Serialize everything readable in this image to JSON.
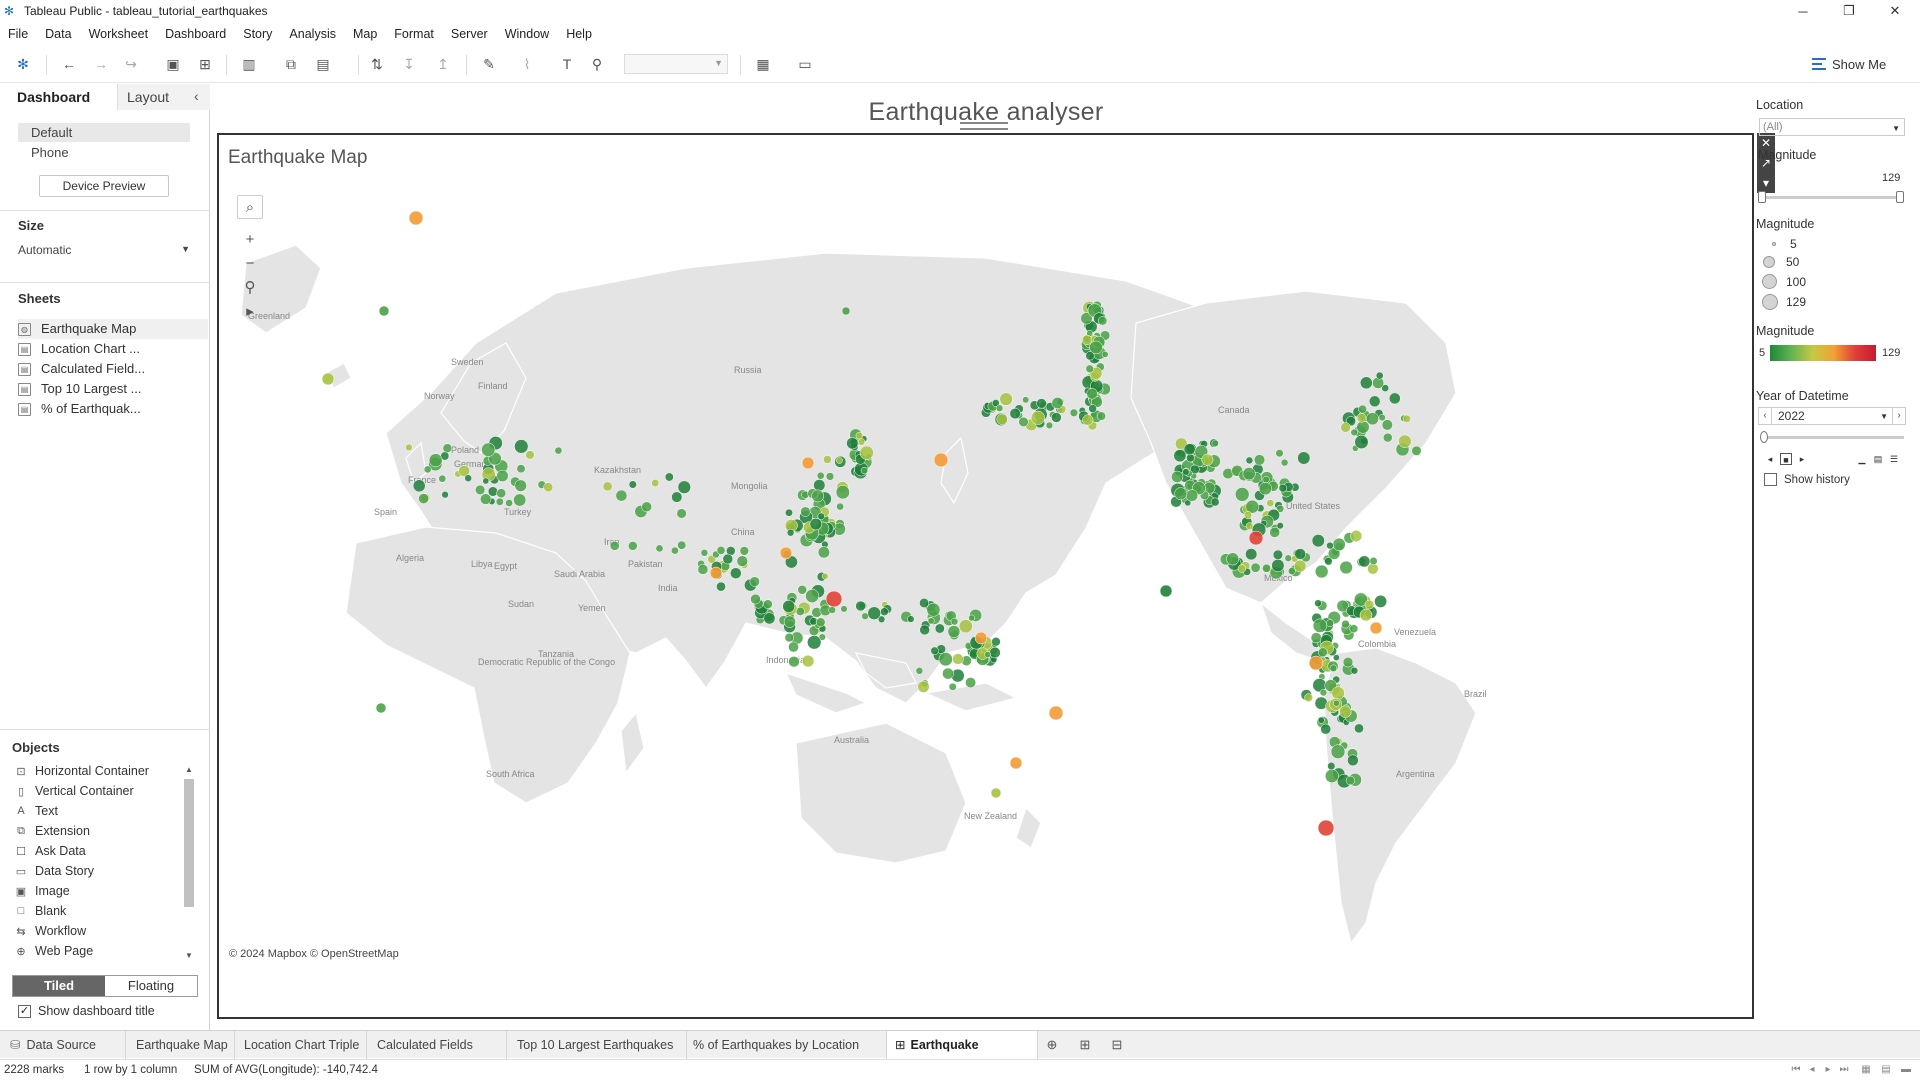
{
  "window": {
    "title": "Tableau Public - tableau_tutorial_earthquakes",
    "minimize": "─",
    "restore": "❐",
    "close": "✕"
  },
  "menu": [
    "File",
    "Data",
    "Worksheet",
    "Dashboard",
    "Story",
    "Analysis",
    "Map",
    "Format",
    "Server",
    "Window",
    "Help"
  ],
  "toolbar": {
    "show_me": "Show Me"
  },
  "left_panel": {
    "tab_dashboard": "Dashboard",
    "tab_layout": "Layout",
    "devices": [
      "Default",
      "Phone"
    ],
    "device_preview": "Device Preview",
    "size_heading": "Size",
    "size_value": "Automatic",
    "sheets_heading": "Sheets",
    "sheets": [
      "Earthquake Map",
      "Location Chart ...",
      "Calculated Field...",
      "Top 10 Largest ...",
      "% of Earthquak..."
    ],
    "objects_heading": "Objects",
    "objects": [
      {
        "icon": "horizontal-container-icon",
        "glyph": "⊡",
        "label": "Horizontal Container"
      },
      {
        "icon": "vertical-container-icon",
        "glyph": "▯",
        "label": "Vertical Container"
      },
      {
        "icon": "text-icon",
        "glyph": "A",
        "label": "Text"
      },
      {
        "icon": "extension-icon",
        "glyph": "⧉",
        "label": "Extension"
      },
      {
        "icon": "ask-data-icon",
        "glyph": "☐",
        "label": "Ask Data"
      },
      {
        "icon": "data-story-icon",
        "glyph": "▭",
        "label": "Data Story"
      },
      {
        "icon": "image-icon",
        "glyph": "▣",
        "label": "Image"
      },
      {
        "icon": "blank-icon",
        "glyph": "□",
        "label": "Blank"
      },
      {
        "icon": "workflow-icon",
        "glyph": "⇆",
        "label": "Workflow"
      },
      {
        "icon": "web-page-icon",
        "glyph": "⊕",
        "label": "Web Page"
      }
    ],
    "tiled": "Tiled",
    "floating": "Floating",
    "show_title": "Show dashboard title"
  },
  "dashboard": {
    "title": "Earthquake analyser",
    "map_title": "Earthquake Map",
    "attribution": "© 2024 Mapbox © OpenStreetMap",
    "map_labels": [
      {
        "text": "Greenland"
      },
      {
        "text": "Russia"
      },
      {
        "text": "Sweden"
      },
      {
        "text": "Finland"
      },
      {
        "text": "Norway"
      },
      {
        "text": "Poland"
      },
      {
        "text": "Germany"
      },
      {
        "text": "France"
      },
      {
        "text": "Spain"
      },
      {
        "text": "Turkey"
      },
      {
        "text": "Kazakhstan"
      },
      {
        "text": "Mongolia"
      },
      {
        "text": "China"
      },
      {
        "text": "Iran"
      },
      {
        "text": "Algeria"
      },
      {
        "text": "Libya"
      },
      {
        "text": "Egypt"
      },
      {
        "text": "Saudi Arabia"
      },
      {
        "text": "Pakistan"
      },
      {
        "text": "India"
      },
      {
        "text": "Yemen"
      },
      {
        "text": "Sudan"
      },
      {
        "text": "Democratic Republic of the Congo"
      },
      {
        "text": "Tanzania"
      },
      {
        "text": "South Africa"
      },
      {
        "text": "Indonesia"
      },
      {
        "text": "Australia"
      },
      {
        "text": "New Zealand"
      },
      {
        "text": "Canada"
      },
      {
        "text": "United States"
      },
      {
        "text": "Mexico"
      },
      {
        "text": "Venezuela"
      },
      {
        "text": "Colombia"
      },
      {
        "text": "Brazil"
      },
      {
        "text": "Argentina"
      }
    ]
  },
  "filters": {
    "location_label": "Location",
    "location_value": "(All)",
    "magnitude_filter_label": "Magnitude",
    "magnitude_max": "129",
    "size_legend_label": "Magnitude",
    "size_legend": [
      "5",
      "50",
      "100",
      "129"
    ],
    "color_legend_label": "Magnitude",
    "color_min": "5",
    "color_max": "129",
    "year_label": "Year of Datetime",
    "year_value": "2022",
    "show_history": "Show history"
  },
  "bottom_tabs": [
    "Data Source",
    "Earthquake Map",
    "Location Chart Triple",
    "Calculated Fields Play",
    "Top 10 Largest Earthquakes",
    "% of Earthquakes by Location B...",
    "Earthquake analyser"
  ],
  "status": {
    "marks": "2228 marks",
    "layout": "1 row by 1 column",
    "sum": "SUM of AVG(Longitude): -140,742.4"
  },
  "colors": {
    "green_dark": "#1e7f3a",
    "green": "#4aa148",
    "yellow_green": "#a6c23f",
    "orange": "#f39a35",
    "red": "#e04335",
    "land": "#e4e4e4",
    "border": "#ffffff"
  }
}
